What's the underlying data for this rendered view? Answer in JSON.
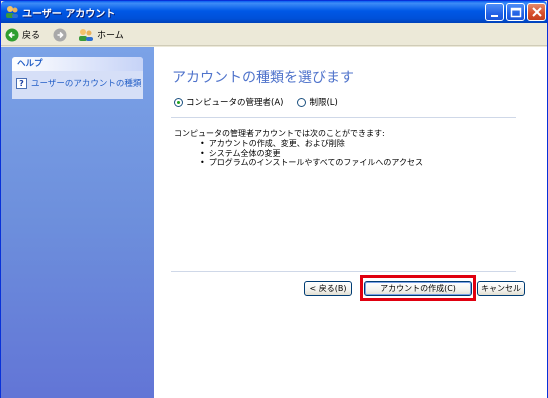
{
  "window": {
    "title": "ユーザー アカウント"
  },
  "toolbar": {
    "back_label": "戻る",
    "home_label": "ホーム"
  },
  "sidebar": {
    "help_title": "ヘルプ",
    "items": [
      {
        "label": "ユーザーのアカウントの種類"
      }
    ]
  },
  "main": {
    "heading": "アカウントの種類を選びます",
    "options": [
      {
        "label": "コンピュータの管理者(A)",
        "selected": true
      },
      {
        "label": "制限(L)",
        "selected": false
      }
    ],
    "description": "コンピュータの管理者アカウントでは次のことができます:",
    "bullets": [
      "アカウントの作成、変更、および削除",
      "システム全体の変更",
      "プログラムのインストールやすべてのファイルへのアクセス"
    ],
    "buttons": {
      "back": "< 戻る(B)",
      "create": "アカウントの作成(C)",
      "cancel": "キャンセル"
    }
  },
  "colors": {
    "title_bar": "#0058e6",
    "sidebar": "#6d8fdc",
    "heading": "#4f73cb",
    "highlight": "#e0000f"
  }
}
